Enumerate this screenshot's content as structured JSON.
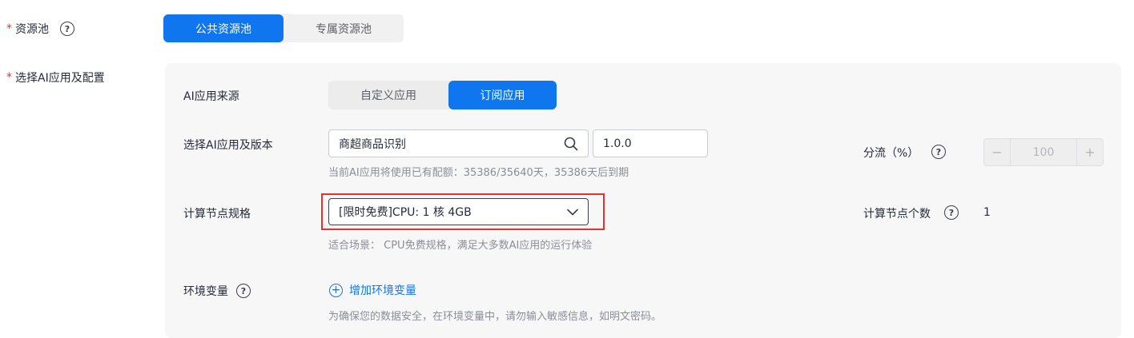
{
  "resource_pool": {
    "label": "资源池",
    "options": [
      "公共资源池",
      "专属资源池"
    ],
    "selected": "公共资源池"
  },
  "app_config": {
    "label": "选择AI应用及配置",
    "source": {
      "label": "AI应用来源",
      "options": [
        "自定义应用",
        "订阅应用"
      ],
      "selected": "订阅应用"
    },
    "app_select": {
      "label": "选择AI应用及版本",
      "app_value": "商超商品识别",
      "version_value": "1.0.0",
      "hint": "当前AI应用将使用已有配额：35386/35640天，35386天后到期"
    },
    "split": {
      "label": "分流（%）",
      "value": "100",
      "minus": "−",
      "plus": "+"
    },
    "spec": {
      "label": "计算节点规格",
      "value": "[限时免费]CPU: 1 核 4GB",
      "hint": "适合场景： CPU免费规格，满足大多数AI应用的运行体验"
    },
    "node_count": {
      "label": "计算节点个数",
      "value": "1"
    },
    "env": {
      "label": "环境变量",
      "add_label": "增加环境变量",
      "hint": "为确保您的数据安全，在环境变量中，请勿输入敏感信息，如明文密码。"
    }
  },
  "icons": {
    "help": "question-circle-icon",
    "search": "search-icon",
    "dropdown": "chevron-down-icon",
    "add": "plus-circle-icon"
  },
  "colors": {
    "accent": "#0f76f0",
    "required": "#e5332d",
    "highlight_border": "#e5332d"
  }
}
